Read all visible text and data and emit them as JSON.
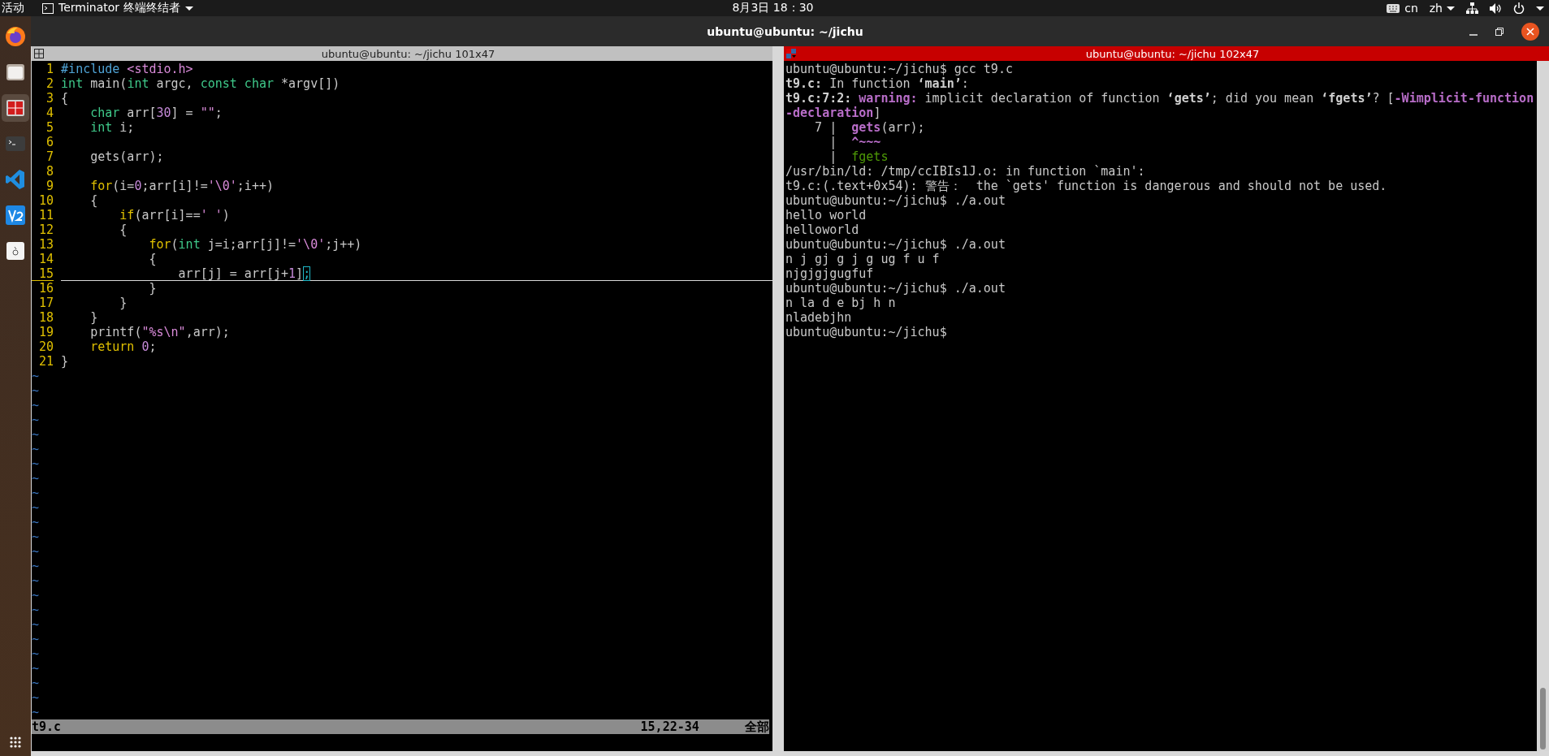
{
  "top_bar": {
    "activities": "活动",
    "app_menu": "Terminator 终端终结者",
    "clock": "8月3日  18：30",
    "input_source": "cn",
    "language": "zh"
  },
  "dock": {
    "items": [
      {
        "kind": "browser",
        "selected": false
      },
      {
        "kind": "files",
        "selected": false
      },
      {
        "kind": "terminator",
        "selected": true
      },
      {
        "kind": "terminal",
        "selected": false
      },
      {
        "kind": "code",
        "selected": false
      },
      {
        "kind": "vnc",
        "selected": false
      },
      {
        "kind": "document",
        "selected": false
      }
    ]
  },
  "window": {
    "title": "ubuntu@ubuntu: ~/jichu"
  },
  "panes": [
    {
      "title": "ubuntu@ubuntu: ~/jichu 101x47",
      "active": false,
      "kind": "editor"
    },
    {
      "title": "ubuntu@ubuntu: ~/jichu 102x47",
      "active": true,
      "kind": "shell"
    }
  ],
  "editor": {
    "lines": [
      {
        "number": "1",
        "current": false,
        "tokens": [
          {
            "text": "#include",
            "kind": "preproc"
          },
          {
            "text": " <stdio.h>",
            "kind": "string"
          }
        ]
      },
      {
        "number": "2",
        "current": false,
        "tokens": [
          {
            "text": "int",
            "kind": "type"
          },
          {
            "text": " main(",
            "kind": "plain"
          },
          {
            "text": "int",
            "kind": "type"
          },
          {
            "text": " argc, ",
            "kind": "plain"
          },
          {
            "text": "const",
            "kind": "type"
          },
          {
            "text": " char",
            "kind": "type"
          },
          {
            "text": " *argv[])",
            "kind": "plain"
          }
        ]
      },
      {
        "number": "3",
        "current": false,
        "tokens": [
          {
            "text": "{",
            "kind": "plain"
          }
        ]
      },
      {
        "number": "4",
        "current": false,
        "tokens": [
          {
            "text": "    char",
            "kind": "type"
          },
          {
            "text": " arr[",
            "kind": "plain"
          },
          {
            "text": "30",
            "kind": "number"
          },
          {
            "text": "] = ",
            "kind": "plain"
          },
          {
            "text": "\"\"",
            "kind": "string"
          },
          {
            "text": ";",
            "kind": "plain"
          }
        ]
      },
      {
        "number": "5",
        "current": false,
        "tokens": [
          {
            "text": "    int",
            "kind": "type"
          },
          {
            "text": " i;",
            "kind": "plain"
          }
        ]
      },
      {
        "number": "6",
        "current": false
      },
      {
        "number": "7",
        "current": false,
        "tokens": [
          {
            "text": "    gets(arr);",
            "kind": "plain"
          }
        ]
      },
      {
        "number": "8",
        "current": false
      },
      {
        "number": "9",
        "current": false,
        "tokens": [
          {
            "text": "    for",
            "kind": "statement"
          },
          {
            "text": "(i=",
            "kind": "plain"
          },
          {
            "text": "0",
            "kind": "number"
          },
          {
            "text": ";arr[i]!=",
            "kind": "plain"
          },
          {
            "text": "'\\0'",
            "kind": "string"
          },
          {
            "text": ";i++)",
            "kind": "plain"
          }
        ]
      },
      {
        "number": "10",
        "current": false,
        "tokens": [
          {
            "text": "    {",
            "kind": "plain"
          }
        ]
      },
      {
        "number": "11",
        "current": false,
        "tokens": [
          {
            "text": "        if",
            "kind": "statement"
          },
          {
            "text": "(arr[i]==",
            "kind": "plain"
          },
          {
            "text": "' '",
            "kind": "string"
          },
          {
            "text": ")",
            "kind": "plain"
          }
        ]
      },
      {
        "number": "12",
        "current": false,
        "tokens": [
          {
            "text": "        {",
            "kind": "plain"
          }
        ]
      },
      {
        "number": "13",
        "current": false,
        "tokens": [
          {
            "text": "            for",
            "kind": "statement"
          },
          {
            "text": "(",
            "kind": "plain"
          },
          {
            "text": "int",
            "kind": "type"
          },
          {
            "text": " j=i;arr[j]!=",
            "kind": "plain"
          },
          {
            "text": "'\\0'",
            "kind": "string"
          },
          {
            "text": ";j++)",
            "kind": "plain"
          }
        ]
      },
      {
        "number": "14",
        "current": false,
        "tokens": [
          {
            "text": "            {",
            "kind": "plain"
          }
        ]
      },
      {
        "number": "15",
        "current": true,
        "tokens": [
          {
            "text": "                arr[j] = arr[j+",
            "kind": "plain"
          },
          {
            "text": "1",
            "kind": "number"
          },
          {
            "text": "]",
            "kind": "plain"
          },
          {
            "text": ";",
            "kind": "plain",
            "cursor": true
          }
        ]
      },
      {
        "number": "16",
        "current": false,
        "tokens": [
          {
            "text": "            }",
            "kind": "plain"
          }
        ]
      },
      {
        "number": "17",
        "current": false,
        "tokens": [
          {
            "text": "        }",
            "kind": "plain"
          }
        ]
      },
      {
        "number": "18",
        "current": false,
        "tokens": [
          {
            "text": "    }",
            "kind": "plain"
          }
        ]
      },
      {
        "number": "19",
        "current": false,
        "tokens": [
          {
            "text": "    printf(",
            "kind": "plain"
          },
          {
            "text": "\"%s\\n\"",
            "kind": "string"
          },
          {
            "text": ",arr);",
            "kind": "plain"
          }
        ]
      },
      {
        "number": "20",
        "current": false,
        "tokens": [
          {
            "text": "    return",
            "kind": "statement"
          },
          {
            "text": " 0",
            "kind": "number"
          },
          {
            "text": ";",
            "kind": "plain"
          }
        ]
      },
      {
        "number": "21",
        "current": false,
        "tokens": [
          {
            "text": "}",
            "kind": "plain"
          }
        ]
      }
    ],
    "filler_lines": [
      "~",
      "~",
      "~",
      "~",
      "~",
      "~",
      "~",
      "~",
      "~",
      "~",
      "~",
      "~",
      "~",
      "~",
      "~",
      "~",
      "~",
      "~",
      "~",
      "~",
      "~",
      "~",
      "~",
      "~"
    ],
    "status_line": {
      "file": "t9.c",
      "position": "15,22-34",
      "scroll": "全部"
    }
  },
  "terminal": {
    "lines": [
      [
        {
          "text": "ubuntu@ubuntu:~/jichu$ gcc t9.c",
          "kind": "plain"
        }
      ],
      [
        {
          "text": "t9.c:",
          "kind": "bold"
        },
        {
          "text": " In function ",
          "kind": "plain"
        },
        {
          "text": "‘main’",
          "kind": "bold"
        },
        {
          "text": ":",
          "kind": "plain"
        }
      ],
      [
        {
          "text": "t9.c:7:2: ",
          "kind": "bold"
        },
        {
          "text": "warning:",
          "kind": "warning"
        },
        {
          "text": " implicit declaration of function ",
          "kind": "plain"
        },
        {
          "text": "‘gets’",
          "kind": "bold"
        },
        {
          "text": "; did you mean ",
          "kind": "plain"
        },
        {
          "text": "‘fgets’",
          "kind": "bold"
        },
        {
          "text": "? [",
          "kind": "plain"
        },
        {
          "text": "-Wimplicit-function",
          "kind": "warning"
        }
      ],
      [
        {
          "text": "-declaration",
          "kind": "warning"
        },
        {
          "text": "]",
          "kind": "plain"
        }
      ],
      [
        {
          "text": "    7 |  ",
          "kind": "plain"
        },
        {
          "text": "gets",
          "kind": "warning"
        },
        {
          "text": "(arr);",
          "kind": "plain"
        }
      ],
      [
        {
          "text": "      |  ",
          "kind": "plain"
        },
        {
          "text": "^~~~",
          "kind": "warning"
        }
      ],
      [
        {
          "text": "      |  ",
          "kind": "plain"
        },
        {
          "text": "fgets",
          "kind": "fixit"
        }
      ],
      [
        {
          "text": "/usr/bin/ld: /tmp/ccIBIs1J.o: in function `main':",
          "kind": "plain"
        }
      ],
      [
        {
          "text": "t9.c:(.text+0x54): 警告：  the `gets' function is dangerous and should not be used.",
          "kind": "plain"
        }
      ],
      [
        {
          "text": "ubuntu@ubuntu:~/jichu$ ./a.out",
          "kind": "plain"
        }
      ],
      [
        {
          "text": "hello world",
          "kind": "plain"
        }
      ],
      [
        {
          "text": "helloworld",
          "kind": "plain"
        }
      ],
      [
        {
          "text": "ubuntu@ubuntu:~/jichu$ ./a.out",
          "kind": "plain"
        }
      ],
      [
        {
          "text": "n j gj g j g ug f u f",
          "kind": "plain"
        }
      ],
      [
        {
          "text": "njgjgjgugfuf",
          "kind": "plain"
        }
      ],
      [
        {
          "text": "ubuntu@ubuntu:~/jichu$ ./a.out",
          "kind": "plain"
        }
      ],
      [
        {
          "text": "n la d e bj h n",
          "kind": "plain"
        }
      ],
      [
        {
          "text": "nladebjhn",
          "kind": "plain"
        }
      ],
      [
        {
          "text": "ubuntu@ubuntu:~/jichu$",
          "kind": "plain"
        }
      ]
    ]
  }
}
